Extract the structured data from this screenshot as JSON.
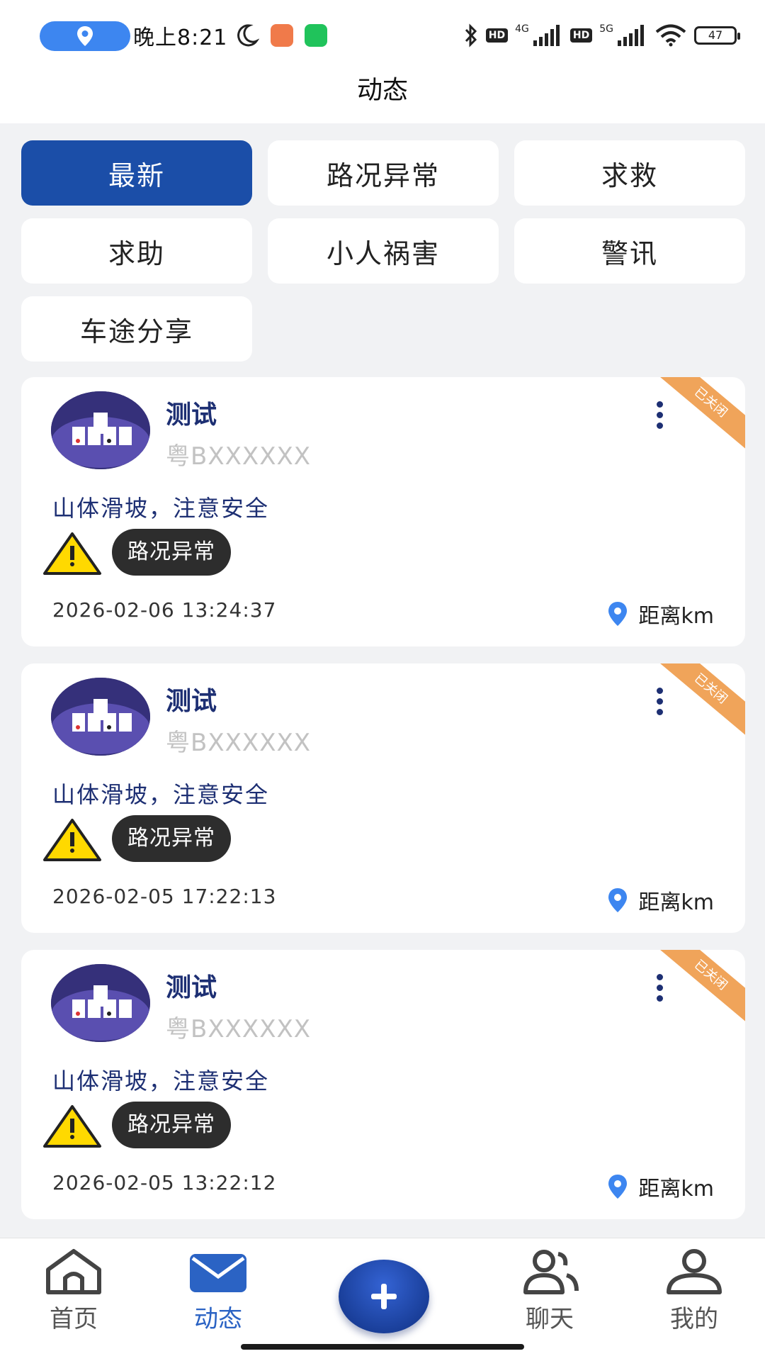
{
  "status_bar": {
    "time": "晚上8:21",
    "network_1": "4G",
    "network_2": "5G",
    "hd_label": "HD",
    "battery": "47"
  },
  "header": {
    "title": "动态"
  },
  "filters": [
    {
      "label": "最新",
      "active": true
    },
    {
      "label": "路况异常",
      "active": false
    },
    {
      "label": "求救",
      "active": false
    },
    {
      "label": "求助",
      "active": false
    },
    {
      "label": "小人祸害",
      "active": false
    },
    {
      "label": "警讯",
      "active": false
    },
    {
      "label": "车途分享",
      "active": false
    }
  ],
  "posts": [
    {
      "username": "测试",
      "plate": "粤BXXXXXX",
      "status_badge": "已关闭",
      "content": "山体滑坡，注意安全",
      "tag": "路况异常",
      "warning_sign_text": "注意安全",
      "timestamp": "2026-02-06 13:24:37",
      "distance": "距离km"
    },
    {
      "username": "测试",
      "plate": "粤BXXXXXX",
      "status_badge": "已关闭",
      "content": "山体滑坡，注意安全",
      "tag": "路况异常",
      "warning_sign_text": "注意安全",
      "timestamp": "2026-02-05 17:22:13",
      "distance": "距离km"
    },
    {
      "username": "测试",
      "plate": "粤BXXXXXX",
      "status_badge": "已关闭",
      "content": "山体滑坡，注意安全",
      "tag": "路况异常",
      "warning_sign_text": "注意安全",
      "timestamp": "2026-02-05 13:22:12",
      "distance": "距离km"
    }
  ],
  "bottom_nav": [
    {
      "label": "首页",
      "icon": "home-icon",
      "active": false
    },
    {
      "label": "动态",
      "icon": "mail-icon",
      "active": true
    },
    {
      "label": "聊天",
      "icon": "users-icon",
      "active": false
    },
    {
      "label": "我的",
      "icon": "user-icon",
      "active": false
    }
  ],
  "colors": {
    "primary": "#1b4ea8",
    "active_nav": "#2b63c4",
    "corner_badge": "#f0a45a",
    "text_dark_blue": "#1d2f73",
    "location_pin": "#3d86f0"
  }
}
